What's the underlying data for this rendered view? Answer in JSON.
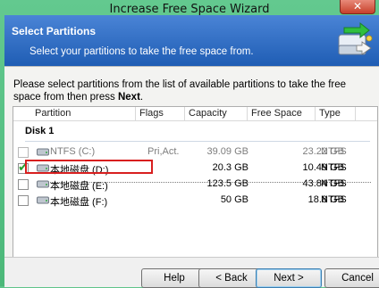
{
  "window": {
    "title": "Increase Free Space Wizard",
    "close_glyph": "✕"
  },
  "header": {
    "title": "Select Partitions",
    "subtitle": "Select your partitions to take the free space from.",
    "icon": "disk-arrow-icon"
  },
  "instructions": {
    "text": "Please select partitions from the list of available partitions to take the free space from then press ",
    "emphasis": "Next",
    "suffix": "."
  },
  "table": {
    "columns": [
      "Partition",
      "Flags",
      "Capacity",
      "Free Space",
      "Type"
    ],
    "group": "Disk 1",
    "rows": [
      {
        "name": "NTFS (C:)",
        "flags": "Pri,Act.",
        "capacity": "39.09 GB",
        "free": "23.22 GB",
        "type": "NTFS",
        "checked": false,
        "disabled": true
      },
      {
        "name": "本地磁盘 (D:)",
        "flags": "",
        "capacity": "20.3 GB",
        "free": "10.49 GB",
        "type": "NTFS",
        "checked": true,
        "disabled": false
      },
      {
        "name": "本地磁盘 (E:)",
        "flags": "",
        "capacity": "123.5 GB",
        "free": "43.84 GB",
        "type": "NTFS",
        "checked": false,
        "disabled": false
      },
      {
        "name": "本地磁盘 (F:)",
        "flags": "",
        "capacity": "50 GB",
        "free": "18.8 GB",
        "type": "NTFS",
        "checked": false,
        "disabled": false
      }
    ]
  },
  "buttons": {
    "help": "Help",
    "back": "< Back",
    "next": "Next >",
    "cancel": "Cancel"
  },
  "colors": {
    "header_bg": "#2f6fc8",
    "selection_outline": "#d81f1f",
    "check": "#2aa132"
  }
}
